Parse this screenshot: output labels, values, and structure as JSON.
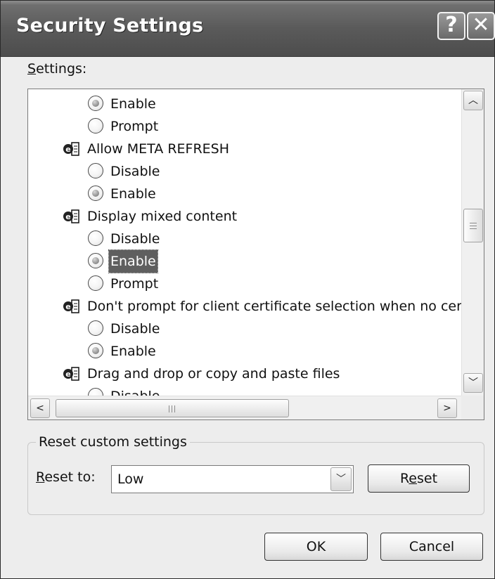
{
  "dialog": {
    "title": "Security Settings",
    "help_button": "?",
    "close_button": "✕"
  },
  "settings_label": {
    "accel": "S",
    "rest": "ettings:"
  },
  "settings_list": {
    "items": [
      {
        "type": "radio",
        "label": "Enable",
        "selected": true
      },
      {
        "type": "radio",
        "label": "Prompt",
        "selected": false
      },
      {
        "type": "category",
        "label": "Allow META REFRESH",
        "icon": "ie-settings-icon"
      },
      {
        "type": "radio",
        "label": "Disable",
        "selected": false
      },
      {
        "type": "radio",
        "label": "Enable",
        "selected": true
      },
      {
        "type": "category",
        "label": "Display mixed content",
        "icon": "ie-settings-icon"
      },
      {
        "type": "radio",
        "label": "Disable",
        "selected": false
      },
      {
        "type": "radio",
        "label": "Enable",
        "selected": true,
        "focused": true
      },
      {
        "type": "radio",
        "label": "Prompt",
        "selected": false
      },
      {
        "type": "category",
        "label": "Don't prompt for client certificate selection when no cer",
        "icon": "ie-settings-icon"
      },
      {
        "type": "radio",
        "label": "Disable",
        "selected": false
      },
      {
        "type": "radio",
        "label": "Enable",
        "selected": true
      },
      {
        "type": "category",
        "label": "Drag and drop or copy and paste files",
        "icon": "ie-settings-icon"
      },
      {
        "type": "radio",
        "label": "Disable",
        "selected": false
      }
    ],
    "scroll_up_icon": "chevron-up-icon",
    "scroll_down_icon": "chevron-down-icon",
    "scroll_left_icon": "chevron-left-icon",
    "scroll_right_icon": "chevron-right-icon"
  },
  "reset_group": {
    "legend": "Reset custom settings",
    "reset_to_accel": "R",
    "reset_to_rest": "eset to:",
    "reset_to_value": "Low",
    "reset_button_pre": "R",
    "reset_button_accel": "e",
    "reset_button_post": "set"
  },
  "buttons": {
    "ok": "OK",
    "cancel": "Cancel"
  }
}
